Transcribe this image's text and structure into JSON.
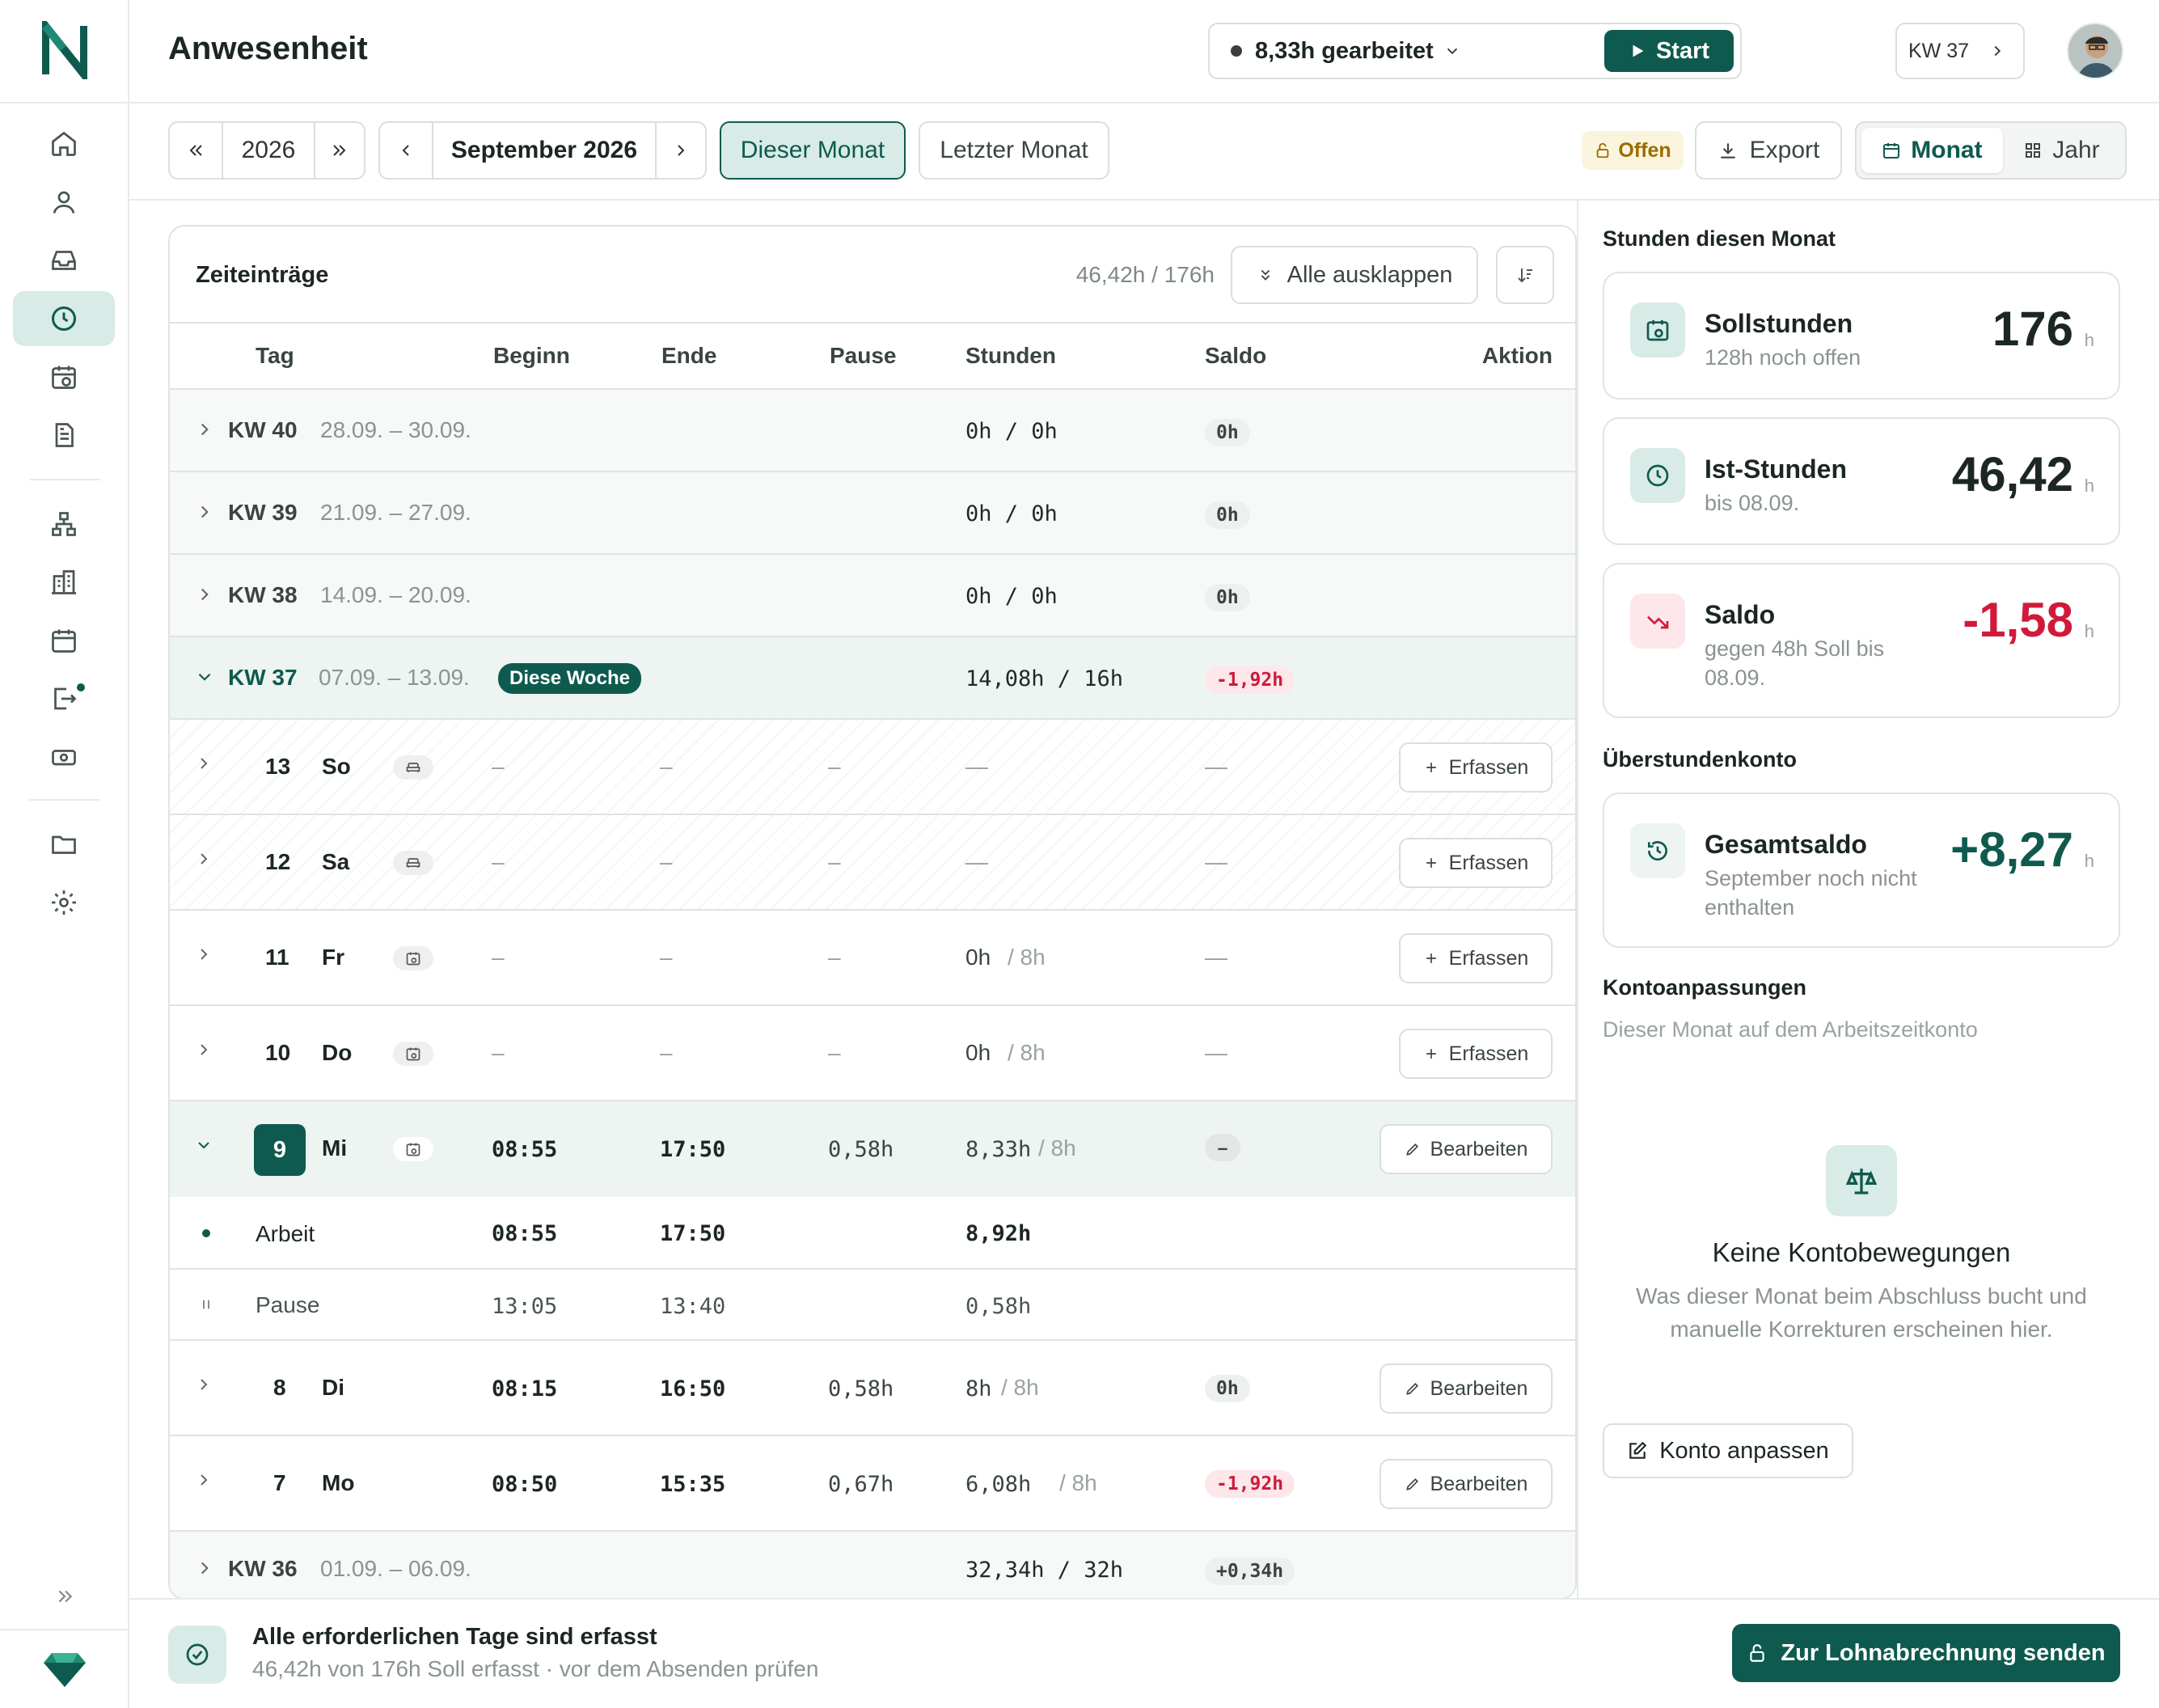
{
  "app": {
    "title": "Anwesenheit"
  },
  "header": {
    "timer_text": "8,33h gearbeitet",
    "start_label": "Start",
    "week_label": "KW 37"
  },
  "toolbar": {
    "year": "2026",
    "month": "September 2026",
    "this_month": "Dieser Monat",
    "last_month": "Letzter Monat",
    "status": "Offen",
    "export": "Export",
    "view_month": "Monat",
    "view_year": "Jahr"
  },
  "entries": {
    "title": "Zeiteinträge",
    "summary": "46,42h / 176h",
    "expand_all": "Alle ausklappen",
    "columns": {
      "tag": "Tag",
      "beginn": "Beginn",
      "ende": "Ende",
      "pause": "Pause",
      "stunden": "Stunden",
      "saldo": "Saldo",
      "aktion": "Aktion"
    },
    "weeks": [
      {
        "kw": "KW 40",
        "range": "28.09. – 30.09.",
        "hours": "0h / 0h",
        "saldo": "0h"
      },
      {
        "kw": "KW 39",
        "range": "21.09. – 27.09.",
        "hours": "0h / 0h",
        "saldo": "0h"
      },
      {
        "kw": "KW 38",
        "range": "14.09. – 20.09.",
        "hours": "0h / 0h",
        "saldo": "0h"
      },
      {
        "kw": "KW 37",
        "range": "07.09. – 13.09.",
        "badge": "Diese Woche",
        "hours": "14,08h / 16h",
        "saldo": "-1,92h"
      },
      {
        "kw": "KW 36",
        "range": "01.09. – 06.09.",
        "hours": "32,34h / 32h",
        "saldo": "+0,34h"
      }
    ],
    "days": [
      {
        "num": "13",
        "wd": "So",
        "begin": "–",
        "end": "–",
        "pause": "–",
        "hours": "—",
        "hours_target": "",
        "saldo": "—",
        "action": "Erfassen"
      },
      {
        "num": "12",
        "wd": "Sa",
        "begin": "–",
        "end": "–",
        "pause": "–",
        "hours": "—",
        "hours_target": "",
        "saldo": "—",
        "action": "Erfassen"
      },
      {
        "num": "11",
        "wd": "Fr",
        "begin": "–",
        "end": "–",
        "pause": "–",
        "hours": "0h",
        "hours_target": "/ 8h",
        "saldo": "—",
        "action": "Erfassen"
      },
      {
        "num": "10",
        "wd": "Do",
        "begin": "–",
        "end": "–",
        "pause": "–",
        "hours": "0h",
        "hours_target": "/ 8h",
        "saldo": "—",
        "action": "Erfassen"
      },
      {
        "num": "9",
        "wd": "Mi",
        "begin": "08:55",
        "end": "17:50",
        "pause": "0,58h",
        "hours": "8,33h",
        "hours_target": "/ 8h",
        "saldo": "–",
        "action": "Bearbeiten"
      },
      {
        "num": "8",
        "wd": "Di",
        "begin": "08:15",
        "end": "16:50",
        "pause": "0,58h",
        "hours": "8h",
        "hours_target": "/ 8h",
        "saldo": "0h",
        "action": "Bearbeiten"
      },
      {
        "num": "7",
        "wd": "Mo",
        "begin": "08:50",
        "end": "15:35",
        "pause": "0,67h",
        "hours": "6,08h",
        "hours_target": "/ 8h",
        "saldo": "-1,92h",
        "action": "Bearbeiten"
      }
    ],
    "segments": [
      {
        "label": "Arbeit",
        "begin": "08:55",
        "end": "17:50",
        "hours": "8,92h"
      },
      {
        "label": "Pause",
        "begin": "13:05",
        "end": "13:40",
        "hours": "0,58h"
      }
    ]
  },
  "stats": {
    "section_title": "Stunden diesen Monat",
    "soll": {
      "title": "Sollstunden",
      "sub": "128h noch offen",
      "value": "176",
      "unit": "h"
    },
    "ist": {
      "title": "Ist-Stunden",
      "sub": "bis 08.09.",
      "value": "46,42",
      "unit": "h"
    },
    "saldo": {
      "title": "Saldo",
      "sub": "gegen 48h Soll bis 08.09.",
      "value": "-1,58",
      "unit": "h"
    }
  },
  "overtime": {
    "section_title": "Überstundenkonto",
    "title": "Gesamtsaldo",
    "sub": "September noch nicht enthalten",
    "value": "+8,27",
    "unit": "h"
  },
  "adjustments": {
    "title": "Kontoanpassungen",
    "sub": "Dieser Monat auf dem Arbeitszeitkonto",
    "empty_title": "Keine Kontobewegungen",
    "empty_text": "Was dieser Monat beim Abschluss bucht und manuelle Korrekturen erscheinen hier.",
    "button": "Konto anpassen"
  },
  "footer": {
    "title": "Alle erforderlichen Tage sind erfasst",
    "sub": "46,42h von 176h Soll erfasst · vor dem Absenden prüfen",
    "send": "Zur Lohnabrechnung senden"
  },
  "colors": {
    "accent": "#0f5a4e",
    "accent_light": "#d8ebe6",
    "negative": "#d11a3b",
    "warning": "#9a6b00"
  }
}
